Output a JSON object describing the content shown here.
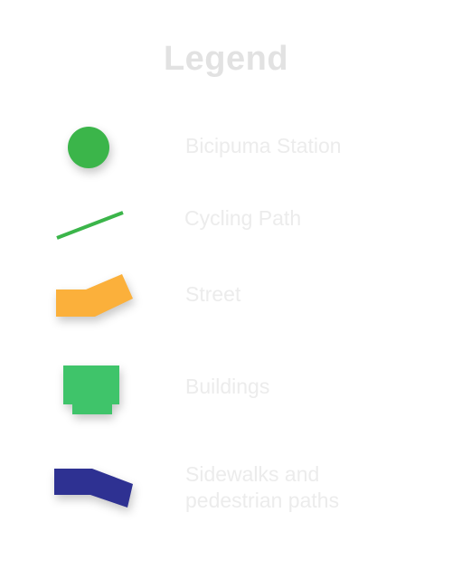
{
  "legend": {
    "title": "Legend",
    "items": [
      {
        "label": "Bicipuma Station",
        "symbol": "station-circle",
        "color": "#3bb54a"
      },
      {
        "label": "Cycling Path",
        "symbol": "cycling-path-line",
        "color": "#3bb54a"
      },
      {
        "label": "Street",
        "symbol": "street-band",
        "color": "#fbb03b"
      },
      {
        "label": "Buildings",
        "symbol": "building-block",
        "color": "#3fc46a"
      },
      {
        "label": "Sidewalks and",
        "label_line2": "pedestrian paths",
        "symbol": "sidewalk-band",
        "color": "#2e3192"
      }
    ]
  }
}
